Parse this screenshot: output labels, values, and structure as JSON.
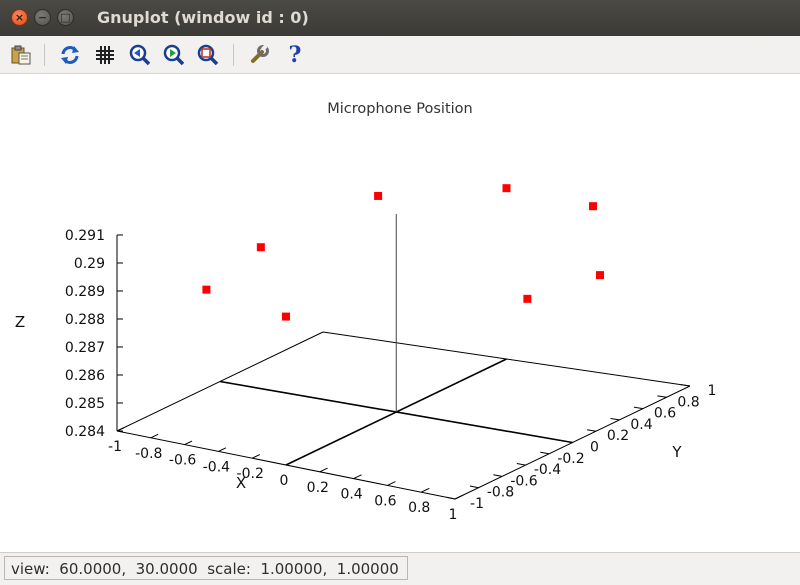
{
  "window": {
    "title": "Gnuplot (window id : 0)",
    "close_glyph": "×",
    "minimize_glyph": "−",
    "maximize_glyph": "□"
  },
  "toolbar": {
    "icons": [
      "copy-to-clipboard-icon",
      "replot-icon",
      "grid-icon",
      "zoom-previous-icon",
      "zoom-next-icon",
      "autoscale-icon",
      "settings-icon",
      "help-icon"
    ],
    "help_glyph": "?"
  },
  "status": {
    "text": "view:  60.0000,  30.0000  scale:  1.00000,  1.00000"
  },
  "colors": {
    "point": "#ff0000",
    "axis": "#000000",
    "titlebar": "#3c3b37",
    "toolbar": "#f2f1f0"
  },
  "chart_data": {
    "type": "scatter",
    "title": "Microphone Position",
    "xlabel": "X",
    "ylabel": "Y",
    "zlabel": "Z",
    "xlim": [
      -1,
      1
    ],
    "ylim": [
      -1,
      1
    ],
    "zlim": [
      0.284,
      0.291
    ],
    "x_ticks": [
      "-1",
      "-0.8",
      "-0.6",
      "-0.4",
      "-0.2",
      "0",
      "0.2",
      "0.4",
      "0.6",
      "0.8",
      "1"
    ],
    "y_ticks": [
      "-1",
      "-0.8",
      "-0.6",
      "-0.4",
      "-0.2",
      "0",
      "0.2",
      "0.4",
      "0.6",
      "0.8",
      "1"
    ],
    "z_ticks": [
      "0.284",
      "0.285",
      "0.286",
      "0.287",
      "0.288",
      "0.289",
      "0.29",
      "0.291"
    ],
    "view": [
      60,
      30
    ],
    "points": [
      {
        "x": -0.95,
        "y": 0.31,
        "z": 0.2883
      },
      {
        "x": -0.59,
        "y": 0.81,
        "z": 0.2896
      },
      {
        "x": 0.0,
        "y": 1.0,
        "z": 0.2901
      },
      {
        "x": 0.59,
        "y": 0.81,
        "z": 0.2904
      },
      {
        "x": 0.95,
        "y": 0.31,
        "z": 0.2893
      },
      {
        "x": 0.95,
        "y": -0.31,
        "z": 0.2897
      },
      {
        "x": -0.59,
        "y": -0.81,
        "z": 0.2892
      },
      {
        "x": 0.0,
        "y": -1.0,
        "z": 0.2893
      }
    ]
  }
}
